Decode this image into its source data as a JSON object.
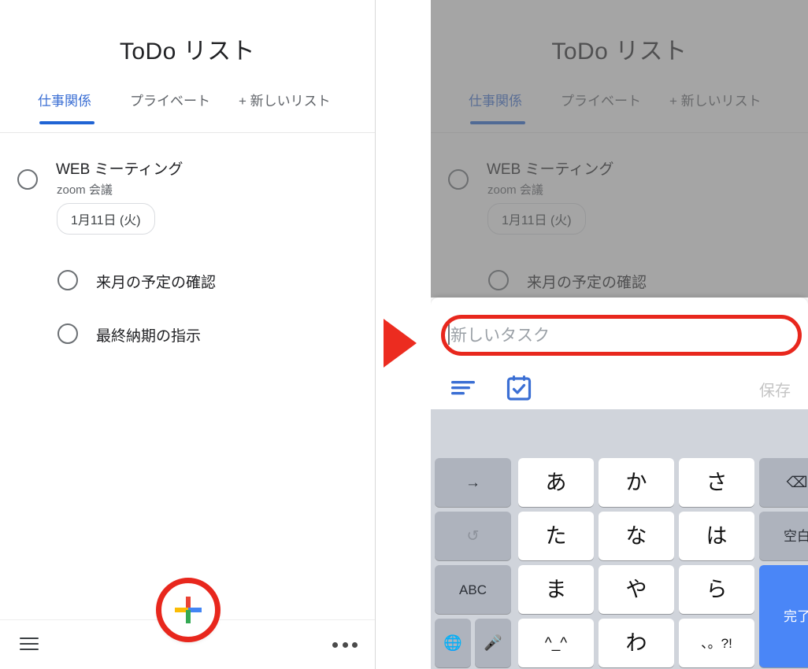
{
  "app": {
    "title": "ToDo リスト",
    "tabs": [
      {
        "label": "仕事関係",
        "active": true
      },
      {
        "label": "プライベート",
        "active": false
      },
      {
        "label": "+ 新しいリスト",
        "active": false
      }
    ],
    "tasks": [
      {
        "title": "WEB ミーティング",
        "note": "zoom 会議",
        "date_chip": "1月11日 (火)"
      },
      {
        "title": "来月の予定の確認",
        "note": "",
        "date_chip": ""
      },
      {
        "title": "最終納期の指示",
        "note": "",
        "date_chip": ""
      }
    ],
    "bottom_bar": {
      "menu_icon": "hamburger-menu-icon",
      "overflow_icon": "overflow-dots-icon",
      "fab_icon": "plus-icon"
    }
  },
  "sheet": {
    "input_placeholder": "新しいタスク",
    "input_value": "",
    "description_icon": "description-lines-icon",
    "date_icon": "calendar-check-icon",
    "save_label": "保存"
  },
  "keyboard": {
    "rows": [
      [
        {
          "label": "→",
          "style": "grey",
          "size": "small",
          "name": "key-arrow-right"
        },
        {
          "label": "あ",
          "style": "white",
          "size": "normal",
          "name": "key-a"
        },
        {
          "label": "か",
          "style": "white",
          "size": "normal",
          "name": "key-ka"
        },
        {
          "label": "さ",
          "style": "white",
          "size": "normal",
          "name": "key-sa"
        },
        {
          "label": "⌫",
          "style": "grey",
          "size": "small",
          "name": "key-backspace"
        }
      ],
      [
        {
          "label": "↺",
          "style": "grey",
          "size": "small",
          "name": "key-undo"
        },
        {
          "label": "た",
          "style": "white",
          "size": "normal",
          "name": "key-ta"
        },
        {
          "label": "な",
          "style": "white",
          "size": "normal",
          "name": "key-na"
        },
        {
          "label": "は",
          "style": "white",
          "size": "normal",
          "name": "key-ha"
        },
        {
          "label": "空白",
          "style": "grey",
          "size": "tiny",
          "name": "key-space"
        }
      ],
      [
        {
          "label": "ABC",
          "style": "grey",
          "size": "tiny",
          "name": "key-abc"
        },
        {
          "label": "ま",
          "style": "white",
          "size": "normal",
          "name": "key-ma"
        },
        {
          "label": "や",
          "style": "white",
          "size": "normal",
          "name": "key-ya"
        },
        {
          "label": "ら",
          "style": "white",
          "size": "normal",
          "name": "key-ra"
        },
        {
          "label": "完了",
          "style": "blue",
          "size": "tiny",
          "name": "key-done"
        }
      ],
      [
        {
          "label": "🌐",
          "style": "grey",
          "size": "small",
          "name": "key-globe"
        },
        {
          "label": "🎤",
          "style": "grey",
          "size": "small",
          "name": "key-mic"
        },
        {
          "label": "^_^",
          "style": "white",
          "size": "small",
          "name": "key-emoticon"
        },
        {
          "label": "わ",
          "style": "white",
          "size": "normal",
          "name": "key-wa"
        },
        {
          "label": "、。?!",
          "style": "white",
          "size": "tiny",
          "name": "key-punct"
        }
      ]
    ]
  },
  "annotations": {
    "fab_highlight": "red-circle-highlight",
    "input_highlight": "red-rounded-rect-highlight",
    "step_arrow": "red-triangle-arrow",
    "highlight_color": "#e8271d"
  }
}
